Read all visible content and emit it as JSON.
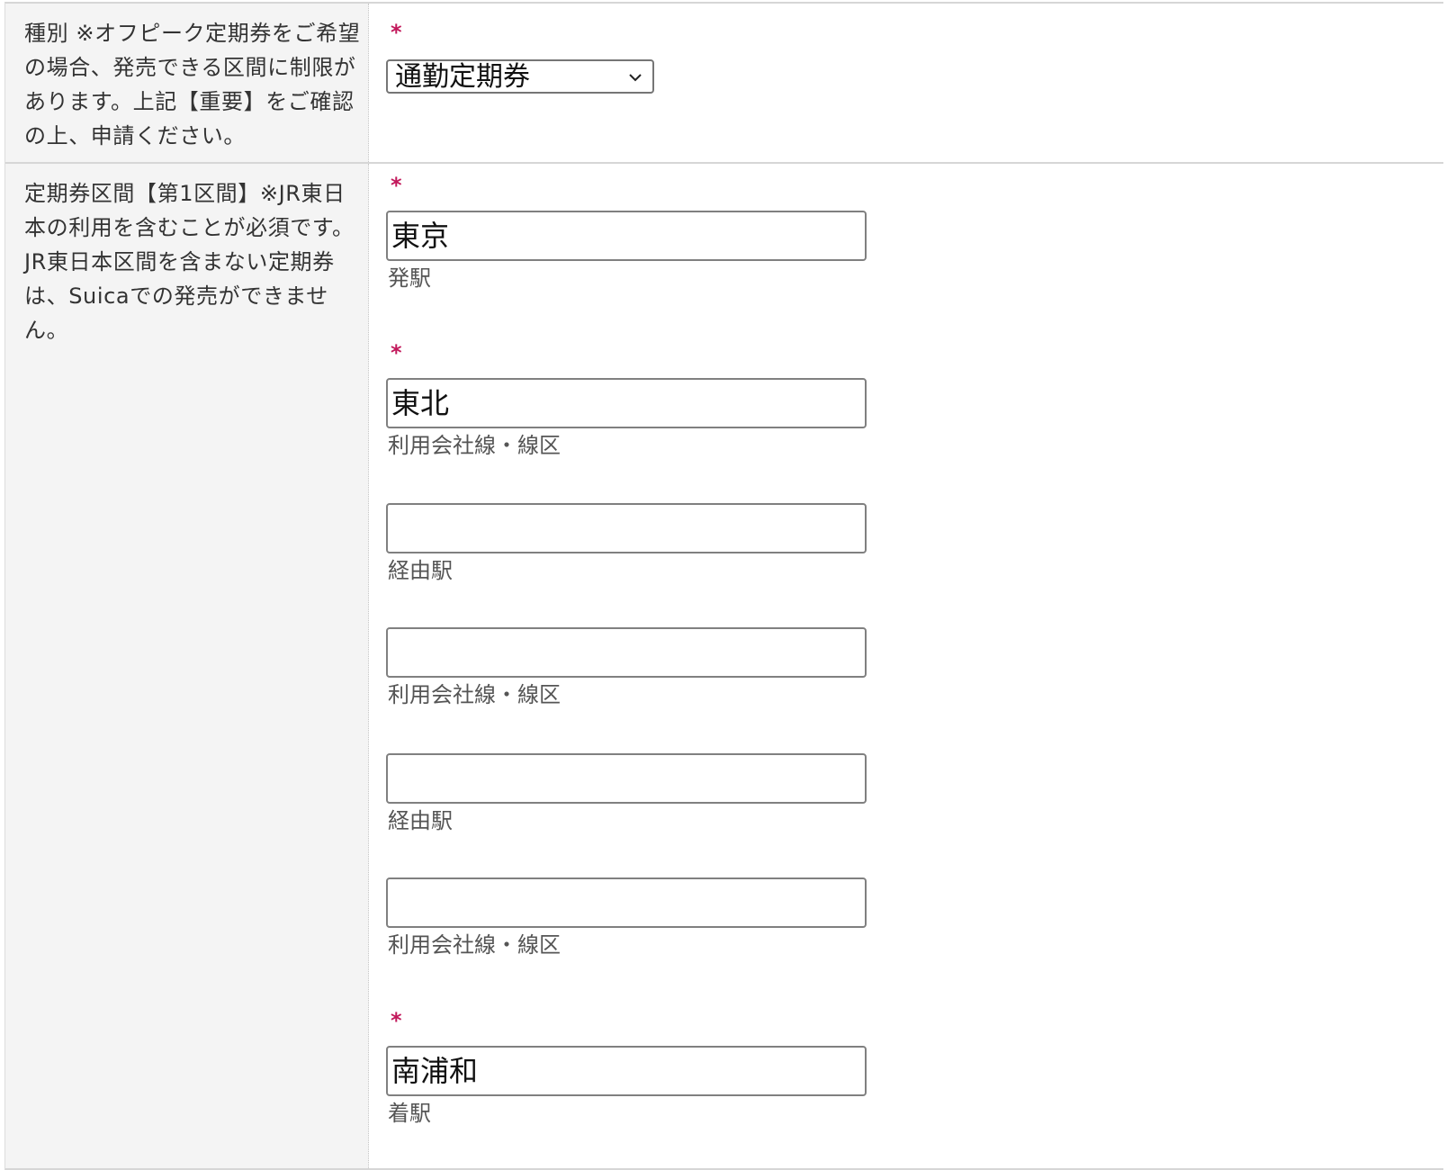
{
  "type_row": {
    "label": "種別 ※オフピーク定期券をご希望の場合、発売できる区間に制限があります。上記【重要】をご確認の上、申請ください。",
    "required_mark": "*",
    "select_value": "通勤定期券"
  },
  "section_row": {
    "label": "定期券区間【第1区間】※JR東日本の利用を含むことが必須です。JR東日本区間を含まない定期券は、Suicaでの発売ができません。",
    "required_mark": "*",
    "fields": [
      {
        "value": "東京",
        "caption": "発駅",
        "required": true
      },
      {
        "value": "東北",
        "caption": "利用会社線・線区",
        "required": true
      },
      {
        "value": "",
        "caption": "経由駅",
        "required": false
      },
      {
        "value": "",
        "caption": "利用会社線・線区",
        "required": false
      },
      {
        "value": "",
        "caption": "経由駅",
        "required": false
      },
      {
        "value": "",
        "caption": "利用会社線・線区",
        "required": false
      },
      {
        "value": "南浦和",
        "caption": "着駅",
        "required": true
      }
    ]
  }
}
